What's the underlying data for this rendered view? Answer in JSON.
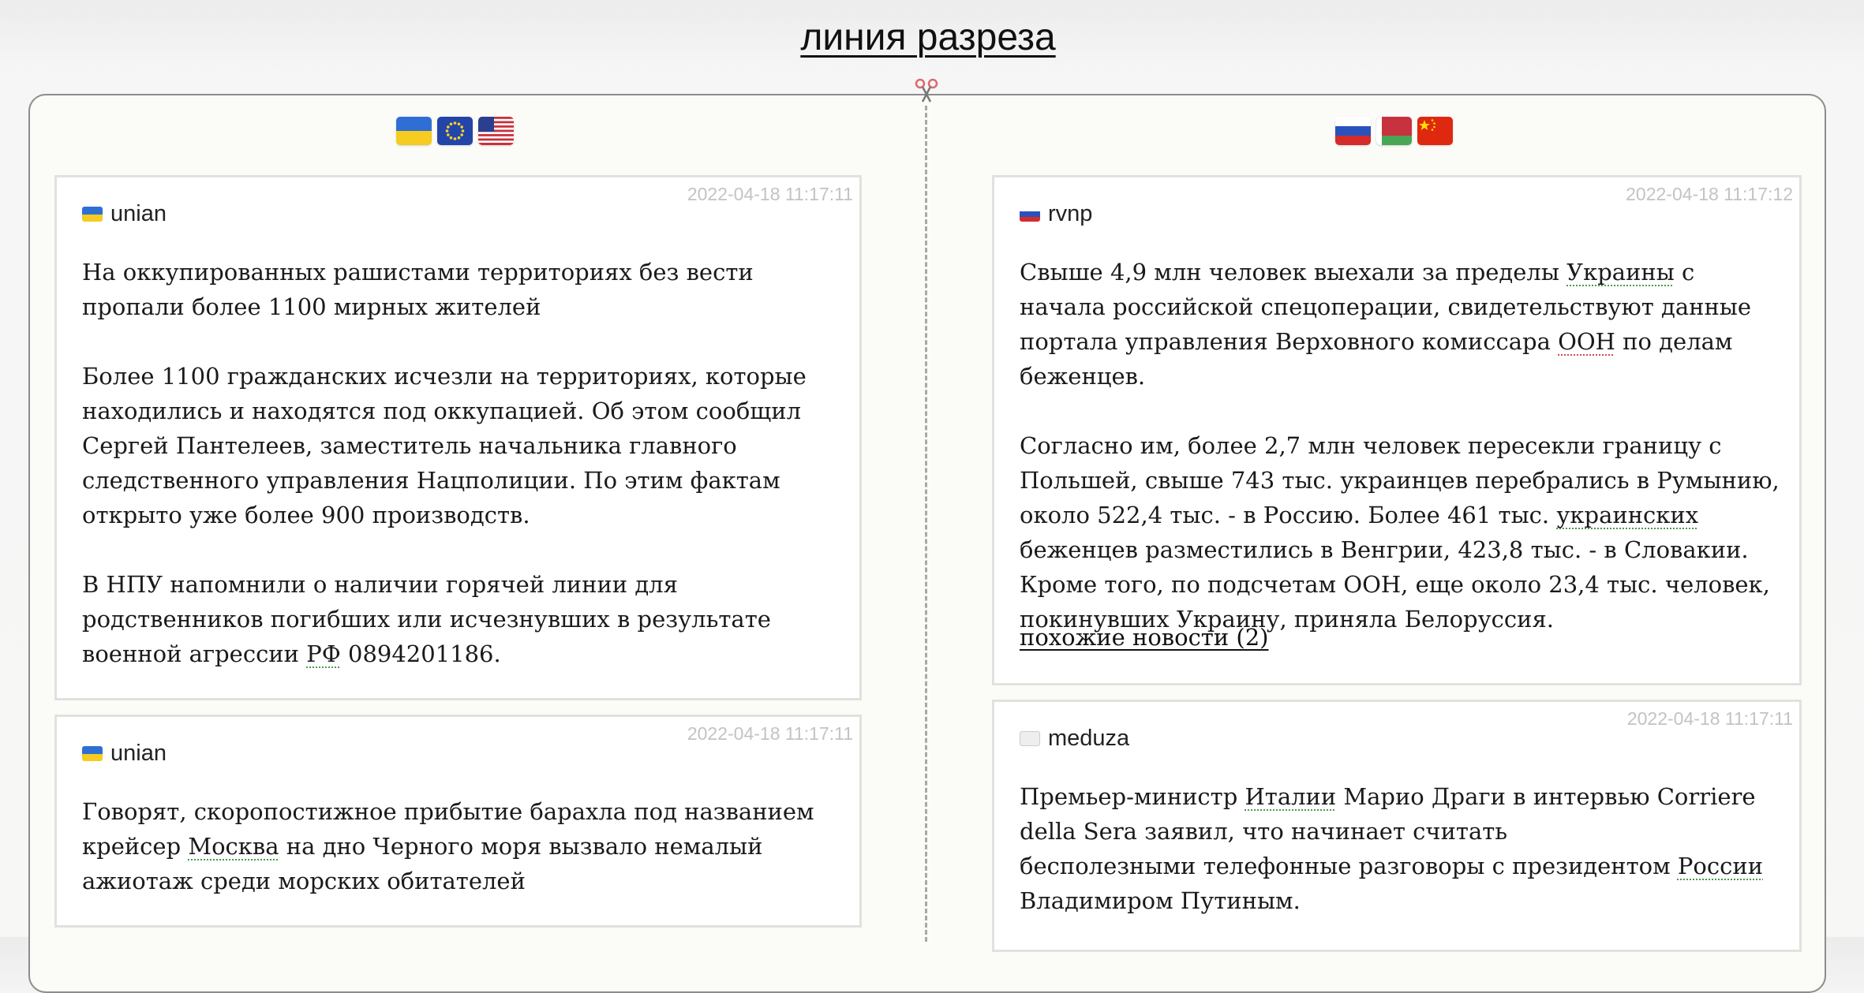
{
  "header": {
    "title": "линия разреза"
  },
  "left_column": {
    "flags": [
      "ukraine-flag",
      "eu-flag",
      "usa-flag"
    ],
    "cards": [
      {
        "timestamp": "2022-04-18 11:17:11",
        "source": "unian",
        "source_flag": "ukraine-flag",
        "headline": "На оккупированных рашистами территориях без вести пропали более 1100 мирных жителей",
        "paragraph_1": "Более 1100 гражданских исчезли на территориях, которые находились и находятся под оккупацией. Об этом сообщил Сергей Пантелеев, заместитель начальника главного следственного управления Нацполиции. По этим фактам открыто уже более 900 производств.",
        "paragraph_2_before": "В НПУ напомнили о наличии горячей линии для родственников погибших или исчезнувших в результате военной агрессии ",
        "paragraph_2_tag": "РФ",
        "paragraph_2_after": " 0894201186."
      },
      {
        "timestamp": "2022-04-18 11:17:11",
        "source": "unian",
        "source_flag": "ukraine-flag",
        "text_before": "Говорят, скоропостижное прибытие барахла под названием крейсер ",
        "text_tag": "Москва",
        "text_after": " на дно Черного моря вызвало немалый ажиотаж среди морских обитателей"
      }
    ]
  },
  "right_column": {
    "flags": [
      "russia-flag",
      "belarus-flag",
      "china-flag"
    ],
    "cards": [
      {
        "timestamp": "2022-04-18 11:17:12",
        "source": "rvnp",
        "source_flag": "russia-flag",
        "p1_a": "Свыше 4,9 млн человек выехали за пределы ",
        "p1_tag1": "Украины",
        "p1_b": " с начала российской спецоперации, свидетельствуют данные портала управления Верховного комиссара ",
        "p1_tag2": "ООН",
        "p1_c": " по делам беженцев.",
        "p2_a": "Согласно им, более 2,7 млн человек пересекли границу с Польшей, свыше 743 тыс. украинцев перебрались в Румынию, около 522,4 тыс. - в Россию. Более 461 тыс. ",
        "p2_tag": "украинских",
        "p2_b": " беженцев разместились в Венгрии, 423,8 тыс. - в Словакии. Кроме того, по подсчетам ООН, еще около 23,4 тыс. человек, покинувших Украину, приняла Белоруссия.",
        "similar_link": "похожие новости (2)"
      },
      {
        "timestamp": "2022-04-18 11:17:11",
        "source": "meduza",
        "source_flag": "white-flag",
        "text_a": "Премьер-министр ",
        "text_tag1": "Италии",
        "text_b": " Марио Драги в интервью Corriere della Sera заявил, что начинает считать\nбесполезными телефонные разговоры с президентом ",
        "text_tag2": "России",
        "text_c": " Владимиром Путиным."
      }
    ]
  },
  "colors": {
    "accent_tag_green": "#4a9a4a",
    "accent_tag_red": "#d24b4b",
    "timestamp_gray": "#c3c3c3"
  }
}
